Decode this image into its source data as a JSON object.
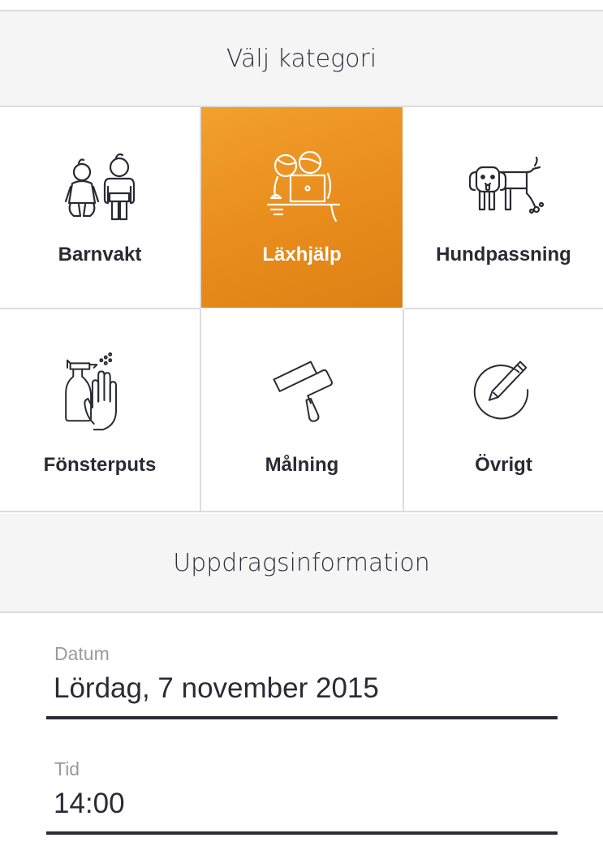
{
  "category_header": {
    "title": "Välj kategori"
  },
  "categories": [
    {
      "id": "barnvakt",
      "label": "Barnvakt",
      "icon": "babysitting-icon",
      "selected": false
    },
    {
      "id": "laxhjalp",
      "label": "Läxhjälp",
      "icon": "homework-help-icon",
      "selected": true
    },
    {
      "id": "hundpassning",
      "label": "Hundpassning",
      "icon": "dog-icon",
      "selected": false
    },
    {
      "id": "fonsterputs",
      "label": "Fönsterputs",
      "icon": "window-cleaning-icon",
      "selected": false
    },
    {
      "id": "malning",
      "label": "Målning",
      "icon": "paint-roller-icon",
      "selected": false
    },
    {
      "id": "ovrigt",
      "label": "Övrigt",
      "icon": "pencil-icon",
      "selected": false
    }
  ],
  "info_header": {
    "title": "Uppdragsinformation"
  },
  "form": {
    "date": {
      "label": "Datum",
      "value": "Lördag, 7 november 2015"
    },
    "time": {
      "label": "Tid",
      "value": "14:00"
    }
  },
  "colors": {
    "accent": "#e88c1c",
    "text": "#2a2a35",
    "header_bg": "#f5f5f5",
    "divider": "#dcdcdc"
  }
}
